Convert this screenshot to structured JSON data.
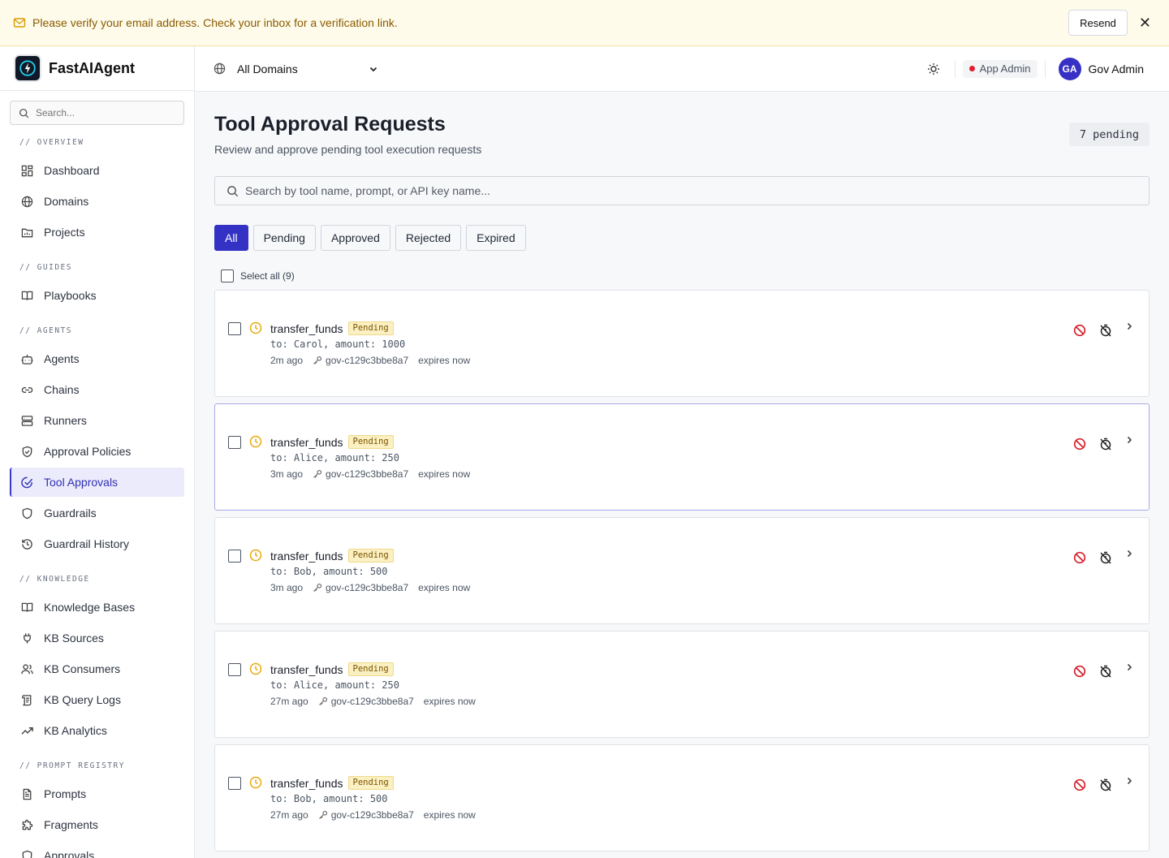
{
  "banner": {
    "message": "Please verify your email address. Check your inbox for a verification link.",
    "resend_label": "Resend"
  },
  "brand": {
    "name": "FastAIAgent"
  },
  "sidebar": {
    "search_placeholder": "Search...",
    "sections": [
      {
        "label": "// OVERVIEW",
        "items": [
          {
            "label": "Dashboard",
            "icon": "dashboard-icon"
          },
          {
            "label": "Domains",
            "icon": "globe-icon"
          },
          {
            "label": "Projects",
            "icon": "folder-icon"
          }
        ]
      },
      {
        "label": "// GUIDES",
        "items": [
          {
            "label": "Playbooks",
            "icon": "book-icon"
          }
        ]
      },
      {
        "label": "// AGENTS",
        "items": [
          {
            "label": "Agents",
            "icon": "bot-icon"
          },
          {
            "label": "Chains",
            "icon": "link-icon"
          },
          {
            "label": "Runners",
            "icon": "server-icon"
          },
          {
            "label": "Approval Policies",
            "icon": "shield-check-icon"
          },
          {
            "label": "Tool Approvals",
            "icon": "check-circle-icon",
            "active": true
          },
          {
            "label": "Guardrails",
            "icon": "shield-icon"
          },
          {
            "label": "Guardrail History",
            "icon": "history-icon"
          }
        ]
      },
      {
        "label": "// KNOWLEDGE",
        "items": [
          {
            "label": "Knowledge Bases",
            "icon": "book-icon"
          },
          {
            "label": "KB Sources",
            "icon": "plug-icon"
          },
          {
            "label": "KB Consumers",
            "icon": "users-icon"
          },
          {
            "label": "KB Query Logs",
            "icon": "scroll-icon"
          },
          {
            "label": "KB Analytics",
            "icon": "trending-icon"
          }
        ]
      },
      {
        "label": "// PROMPT REGISTRY",
        "items": [
          {
            "label": "Prompts",
            "icon": "file-text-icon"
          },
          {
            "label": "Fragments",
            "icon": "puzzle-icon"
          },
          {
            "label": "Approvals",
            "icon": "shield-icon"
          }
        ]
      }
    ]
  },
  "header": {
    "domain": "All Domains",
    "role": "App Admin",
    "role_dot_color": "#e11d2e",
    "user_initials": "GA",
    "user_name": "Gov Admin"
  },
  "main": {
    "title": "Tool Approval Requests",
    "subtitle": "Review and approve pending tool execution requests",
    "pending_badge": "7 pending",
    "search_placeholder": "Search by tool name, prompt, or API key name...",
    "filters": [
      {
        "label": "All",
        "active": true
      },
      {
        "label": "Pending"
      },
      {
        "label": "Approved"
      },
      {
        "label": "Rejected"
      },
      {
        "label": "Expired"
      }
    ],
    "select_all_label": "Select all (9)",
    "requests": [
      {
        "tool": "transfer_funds",
        "status": "Pending",
        "args": "to: Carol, amount: 1000",
        "time": "2m ago",
        "api_key": "gov-c129c3bbe8a7",
        "expires": "expires now"
      },
      {
        "tool": "transfer_funds",
        "status": "Pending",
        "args": "to: Alice, amount: 250",
        "time": "3m ago",
        "api_key": "gov-c129c3bbe8a7",
        "expires": "expires now",
        "hover": true
      },
      {
        "tool": "transfer_funds",
        "status": "Pending",
        "args": "to: Bob, amount: 500",
        "time": "3m ago",
        "api_key": "gov-c129c3bbe8a7",
        "expires": "expires now"
      },
      {
        "tool": "transfer_funds",
        "status": "Pending",
        "args": "to: Alice, amount: 250",
        "time": "27m ago",
        "api_key": "gov-c129c3bbe8a7",
        "expires": "expires now"
      },
      {
        "tool": "transfer_funds",
        "status": "Pending",
        "args": "to: Bob, amount: 500",
        "time": "27m ago",
        "api_key": "gov-c129c3bbe8a7",
        "expires": "expires now"
      }
    ]
  },
  "colors": {
    "accent": "#3432c4",
    "pending_bg": "#fbf0c2",
    "reject": "#d6202c",
    "clock": "#e8a90c"
  }
}
